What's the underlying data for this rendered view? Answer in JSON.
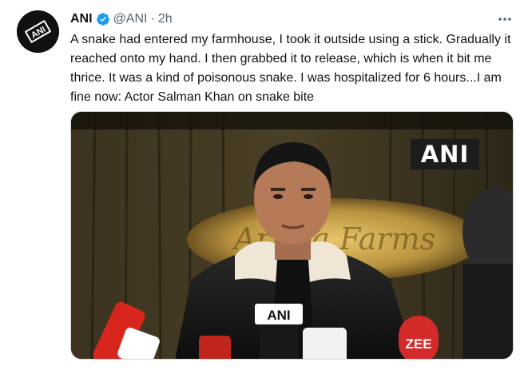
{
  "tweet": {
    "author_name": "ANI",
    "handle": "@ANI",
    "separator": "·",
    "time": "2h",
    "text": "A snake had entered my farmhouse, I took it outside using a stick. Gradually it reached onto my hand. I then grabbed it to release, which is when it bit me thrice. It was a kind of poisonous snake. I was hospitalized for 6 hours...I am fine now: Actor Salman Khan on snake bite",
    "avatar_logo_text": "ANI",
    "verified_icon": "verified-badge-icon",
    "more_icon": "more-options-icon",
    "colors": {
      "verified": "#1d9bf0",
      "secondary_text": "#536471",
      "primary_text": "#0f1419"
    }
  },
  "media": {
    "watermark": "ANI",
    "mic_labels": [
      "ANI",
      "ZEE"
    ]
  }
}
